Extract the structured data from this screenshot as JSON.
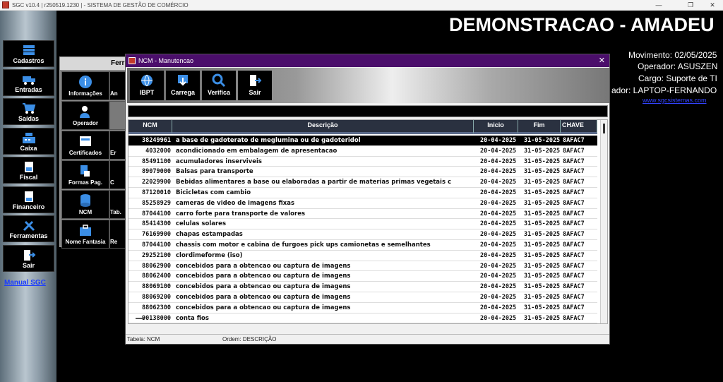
{
  "window": {
    "title": "SGC v10.4 | r250519.1230 | - SISTEMA DE GESTÃO DE COMÉRCIO",
    "minimize": "—",
    "restore": "❐",
    "close": "✕"
  },
  "sidebar": {
    "items": [
      {
        "label": "Cadastros",
        "icon": "database-icon"
      },
      {
        "label": "Entradas",
        "icon": "truck-icon"
      },
      {
        "label": "Saídas",
        "icon": "cart-icon"
      },
      {
        "label": "Caixa",
        "icon": "register-icon"
      },
      {
        "label": "Fiscal",
        "icon": "document-icon"
      },
      {
        "label": "Financeiro",
        "icon": "ledger-icon"
      },
      {
        "label": "Ferramentas",
        "icon": "tools-icon"
      },
      {
        "label": "Sair",
        "icon": "exit-icon"
      }
    ],
    "manual": "Manual SGC"
  },
  "header": {
    "company": "DEMONSTRACAO - AMADEU",
    "movimento": "Movimento: 02/05/2025",
    "operador": "Operador: ASUSZEN",
    "cargo": "Cargo: Suporte de TI",
    "computador": "ador: LAPTOP-FERNANDO",
    "site": "www.sgcsistemas.com"
  },
  "ferramentas": {
    "title": "Ferr",
    "tiles": [
      {
        "label": "Informações",
        "icon": "info-icon"
      },
      {
        "label": "Operador",
        "icon": "user-icon"
      },
      {
        "label": "Certificados",
        "icon": "certificate-icon"
      },
      {
        "label": "Formas Pag.",
        "icon": "payment-icon"
      },
      {
        "label": "NCM",
        "icon": "database-icon"
      },
      {
        "label": "Nome Fantasia",
        "icon": "briefcase-icon"
      }
    ],
    "partial": [
      "An",
      "",
      "Er",
      "C",
      "Tab.",
      "Re"
    ]
  },
  "dialog": {
    "title": "NCM - Manutencao",
    "close": "✕",
    "toolbar": [
      {
        "label": "IBPT",
        "icon": "globe-icon"
      },
      {
        "label": "Carrega",
        "icon": "download-icon"
      },
      {
        "label": "Verifica",
        "icon": "magnifier-icon"
      },
      {
        "label": "Sair",
        "icon": "exit-icon"
      }
    ],
    "columns": [
      "NCM",
      "Descrição",
      "Inicio",
      "Fim",
      "CHAVE"
    ],
    "rows": [
      {
        "ncm": "38249961",
        "desc": "a base de gadoterato de meglumina ou de gadoteridol",
        "ini": "20-04-2025",
        "fim": "31-05-2025",
        "key": "8AFAC7"
      },
      {
        "ncm": "4032000",
        "desc": "acondicionado em embalagem de apresentacao",
        "ini": "20-04-2025",
        "fim": "31-05-2025",
        "key": "8AFAC7"
      },
      {
        "ncm": "85491100",
        "desc": "acumuladores inserviveis",
        "ini": "20-04-2025",
        "fim": "31-05-2025",
        "key": "8AFAC7"
      },
      {
        "ncm": "89079000",
        "desc": "Balsas para transporte",
        "ini": "20-04-2025",
        "fim": "31-05-2025",
        "key": "8AFAC7"
      },
      {
        "ncm": "22029900",
        "desc": "Bebidas alimentares a base ou elaboradas a partir de materias primas vegetais c",
        "ini": "20-04-2025",
        "fim": "31-05-2025",
        "key": "8AFAC7"
      },
      {
        "ncm": "87120010",
        "desc": "Bicicletas com cambio",
        "ini": "20-04-2025",
        "fim": "31-05-2025",
        "key": "8AFAC7"
      },
      {
        "ncm": "85258929",
        "desc": "cameras de video de imagens fixas",
        "ini": "20-04-2025",
        "fim": "31-05-2025",
        "key": "8AFAC7"
      },
      {
        "ncm": "87044100",
        "desc": "carro forte para transporte de valores",
        "ini": "20-04-2025",
        "fim": "31-05-2025",
        "key": "8AFAC7"
      },
      {
        "ncm": "85414300",
        "desc": "celulas solares",
        "ini": "20-04-2025",
        "fim": "31-05-2025",
        "key": "8AFAC7"
      },
      {
        "ncm": "76169900",
        "desc": "chapas estampadas",
        "ini": "20-04-2025",
        "fim": "31-05-2025",
        "key": "8AFAC7"
      },
      {
        "ncm": "87044100",
        "desc": "chassis com motor e cabina de furgoes pick ups camionetas e semelhantes",
        "ini": "20-04-2025",
        "fim": "31-05-2025",
        "key": "8AFAC7"
      },
      {
        "ncm": "29252100",
        "desc": "clordimeforme (iso)",
        "ini": "20-04-2025",
        "fim": "31-05-2025",
        "key": "8AFAC7"
      },
      {
        "ncm": "88062900",
        "desc": "concebidos para a obtencao ou captura de imagens",
        "ini": "20-04-2025",
        "fim": "31-05-2025",
        "key": "8AFAC7"
      },
      {
        "ncm": "88062400",
        "desc": "concebidos para a obtencao ou captura de imagens",
        "ini": "20-04-2025",
        "fim": "31-05-2025",
        "key": "8AFAC7"
      },
      {
        "ncm": "88069100",
        "desc": "concebidos para a obtencao ou captura de imagens",
        "ini": "20-04-2025",
        "fim": "31-05-2025",
        "key": "8AFAC7"
      },
      {
        "ncm": "88069200",
        "desc": "concebidos para a obtencao ou captura de imagens",
        "ini": "20-04-2025",
        "fim": "31-05-2025",
        "key": "8AFAC7"
      },
      {
        "ncm": "88062300",
        "desc": "concebidos para a obtencao ou captura de imagens",
        "ini": "20-04-2025",
        "fim": "31-05-2025",
        "key": "8AFAC7"
      },
      {
        "ncm": "90138000",
        "desc": "conta fios",
        "ini": "20-04-2025",
        "fim": "31-05-2025",
        "key": "8AFAC7"
      }
    ],
    "status": {
      "tabela": "Tabela: NCM",
      "ordem": "Ordem: DESCRIÇÃO"
    }
  }
}
